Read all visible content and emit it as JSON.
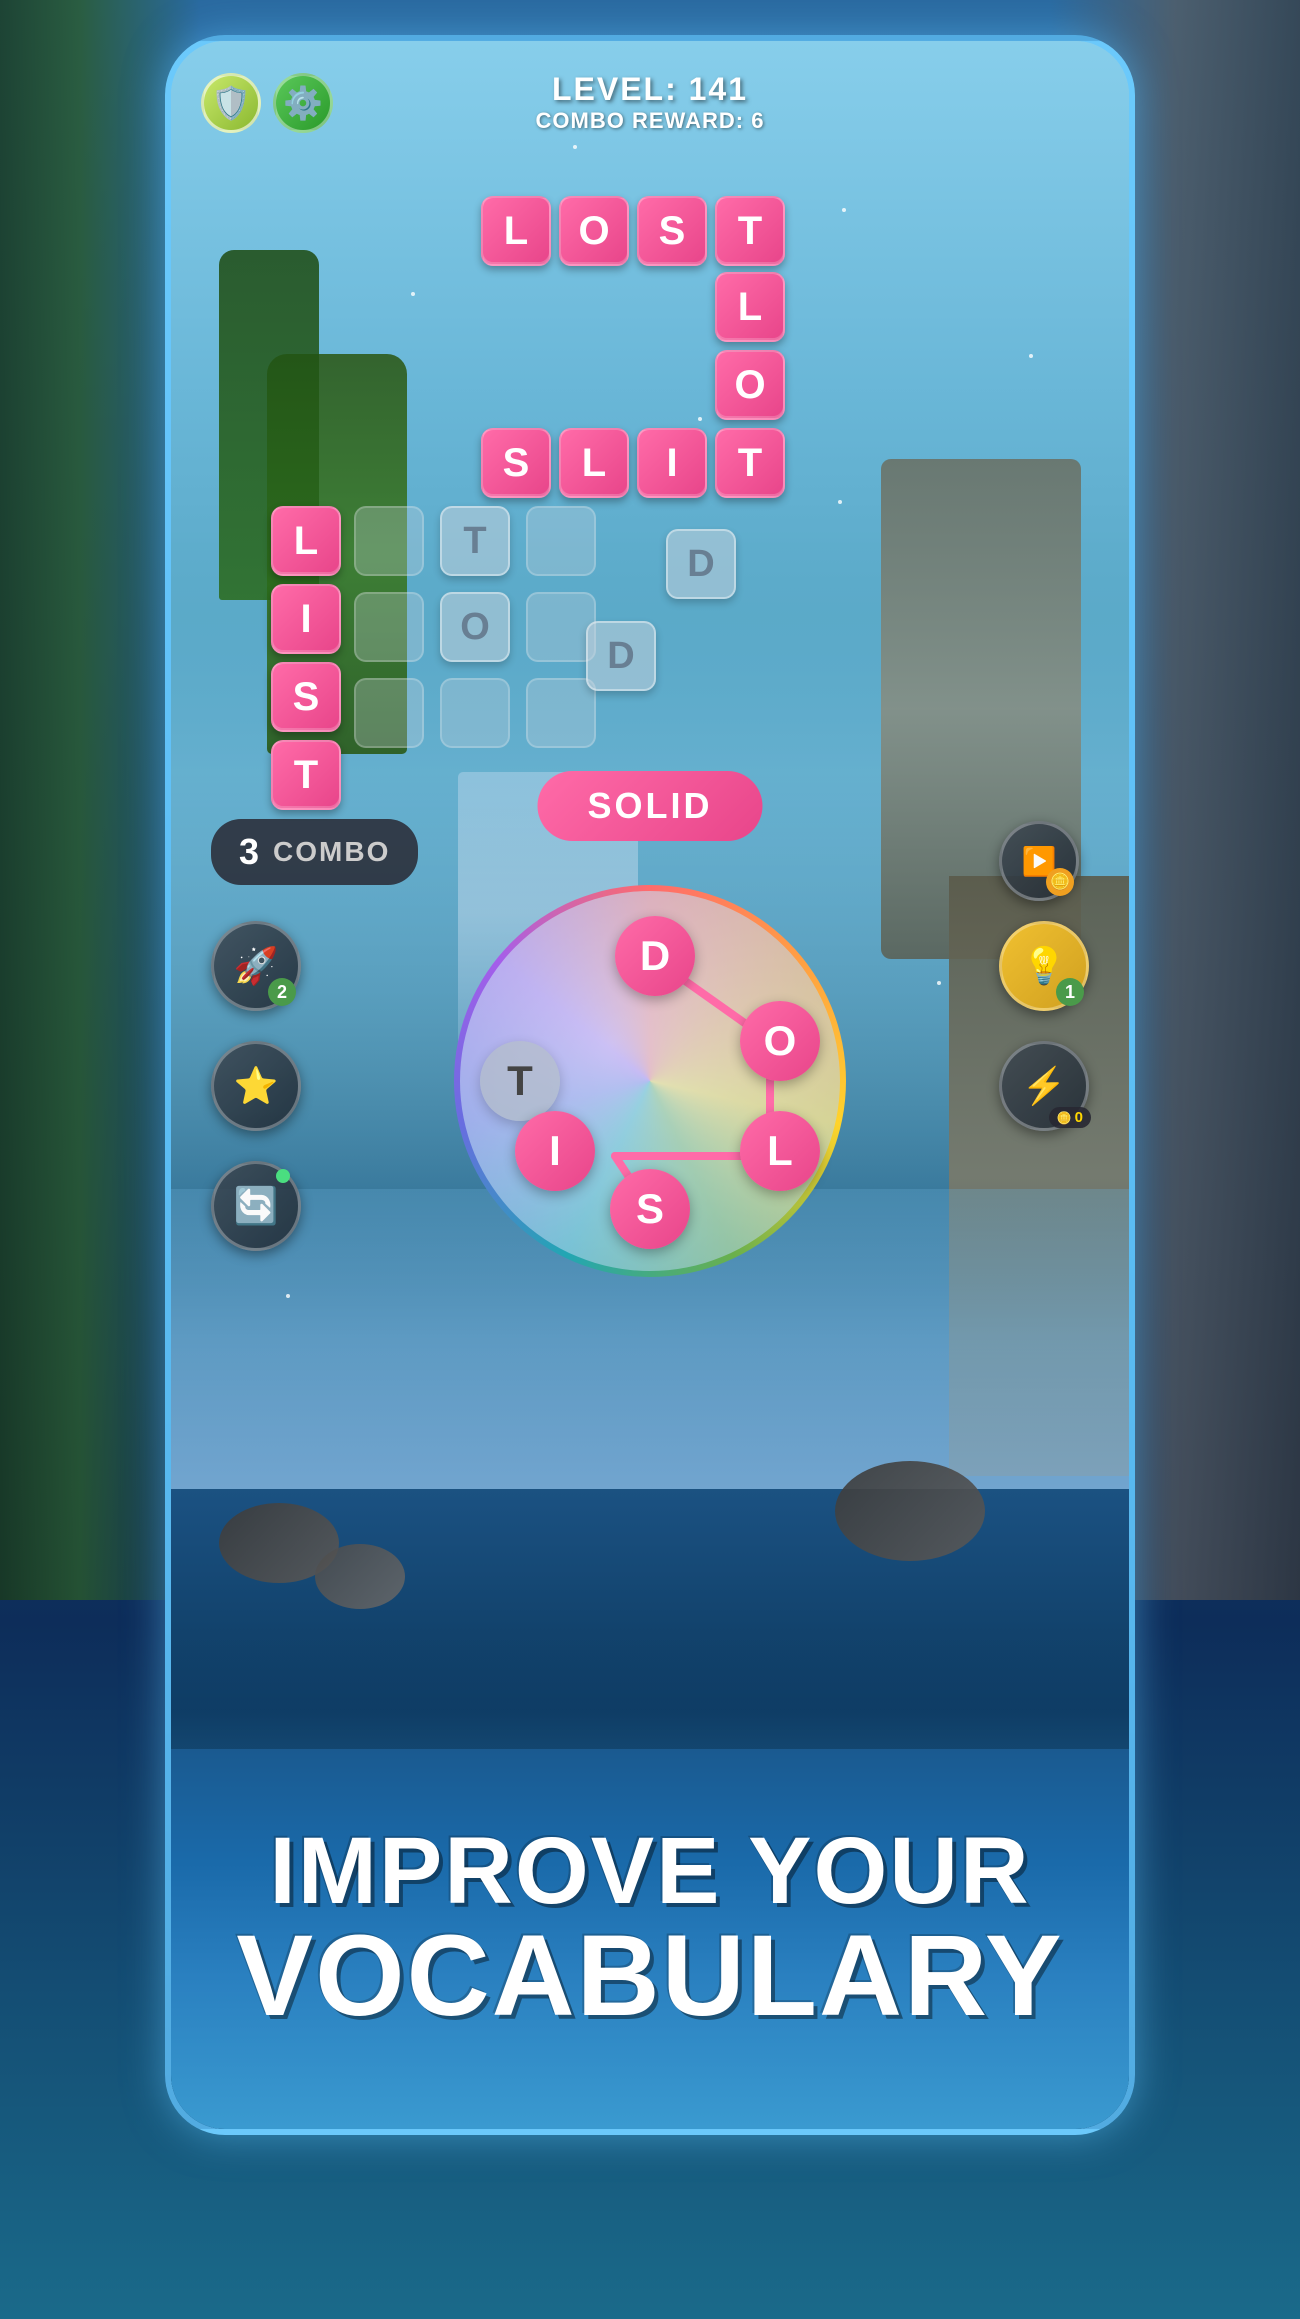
{
  "header": {
    "level_label": "LEVEL: 141",
    "combo_reward_label": "COMBO REWARD: 6"
  },
  "crossword": {
    "row_lost": [
      "L",
      "O",
      "S",
      "T"
    ],
    "col_vertical_l": [
      "L"
    ],
    "col_vertical_o": [
      "O"
    ],
    "row_slit": [
      "S",
      "L",
      "I",
      "T"
    ],
    "col_list": [
      "L",
      "I",
      "S",
      "T"
    ],
    "grid_letters": {
      "T": "T",
      "O": "O",
      "D1": "D",
      "D2": "D"
    }
  },
  "combo": {
    "number": "3",
    "label": "COMBO"
  },
  "current_word": "SOLID",
  "wheel_letters": {
    "D": "D",
    "O": "O",
    "L": "L",
    "S": "S",
    "I": "I",
    "T": "T"
  },
  "side_buttons": {
    "rocket_badge": "2",
    "hint_badge": "1",
    "lightning_badge": "0"
  },
  "bottom_text": {
    "line1": "IMPROVE YOUR",
    "line2": "VOCABULARY"
  },
  "icons": {
    "shield": "🛡",
    "gear": "⚙",
    "rocket": "🚀",
    "star": "⭐",
    "refresh": "🔄",
    "bulb": "💡",
    "video": "▶",
    "lightning": "⚡",
    "coins": "🪙"
  }
}
